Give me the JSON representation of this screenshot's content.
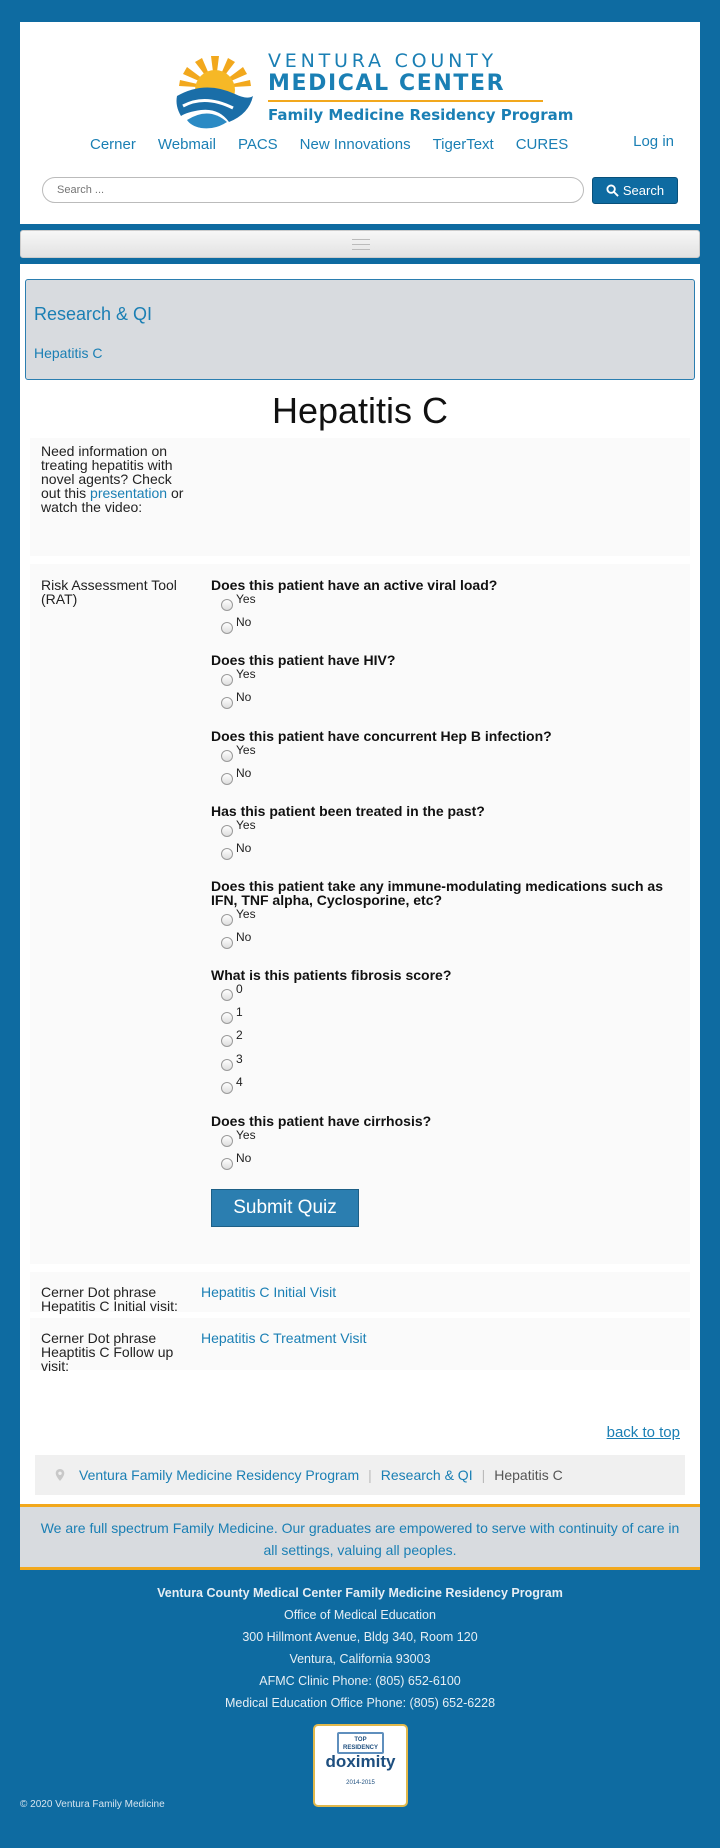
{
  "header": {
    "logo": {
      "line1": "VENTURA COUNTY",
      "line2": "MEDICAL CENTER",
      "line3": "Family Medicine Residency Program"
    },
    "nav": [
      "Cerner",
      "Webmail",
      "PACS",
      "New Innovations",
      "TigerText",
      "CURES"
    ],
    "login_label": "Log in",
    "search": {
      "placeholder": "Search ...",
      "button_label": "Search"
    }
  },
  "breadcrumb_box": {
    "title": "Research & QI",
    "subtitle": "Hepatitis C"
  },
  "page_title": "Hepatitis C",
  "info": {
    "text_before": "Need information on treating hepatitis with novel agents?  Check out this",
    "link": "presentation",
    "text_after": "or watch the video:"
  },
  "rat": {
    "label": "Risk Assessment Tool (RAT)",
    "questions": [
      {
        "q": "Does this patient have an active viral load?",
        "options": [
          "Yes",
          "No"
        ]
      },
      {
        "q": "Does this patient have HIV?",
        "options": [
          "Yes",
          "No"
        ]
      },
      {
        "q": "Does this patient have concurrent Hep B infection?",
        "options": [
          "Yes",
          "No"
        ]
      },
      {
        "q": "Has this patient been treated in the past?",
        "options": [
          "Yes",
          "No"
        ]
      },
      {
        "q": "Does this patient take any immune-modulating medications such as IFN, TNF alpha, Cyclosporine, etc?",
        "options": [
          "Yes",
          "No"
        ]
      },
      {
        "q": "What is this patients fibrosis score?",
        "options": [
          "0",
          "1",
          "2",
          "3",
          "4"
        ]
      },
      {
        "q": "Does this patient have cirrhosis?",
        "options": [
          "Yes",
          "No"
        ]
      }
    ],
    "submit_label": "Submit Quiz"
  },
  "dot_phrases": [
    {
      "label": "Cerner Dot phrase Hepatitis C Initial visit:",
      "link": "Hepatitis C Initial Visit"
    },
    {
      "label": "Cerner Dot phrase Heaptitis C Follow up visit:",
      "link": "Hepatitis C Treatment Visit"
    }
  ],
  "back_to_top": "back to top",
  "breadcrumbs": [
    "Ventura Family Medicine Residency Program",
    "Research & QI",
    "Hepatitis C"
  ],
  "tagline": "We are full spectrum Family Medicine. Our graduates are empowered to serve with continuity of care in all settings, valuing all peoples.",
  "footer": {
    "org": "Ventura County Medical Center Family Medicine Residency Program",
    "lines": [
      "Office of Medical Education",
      "300 Hillmont Avenue, Bldg 340, Room 120",
      "Ventura, California 93003",
      "AFMC Clinic Phone: (805) 652-6100",
      "Medical Education Office Phone: (805) 652-6228"
    ],
    "badge": {
      "top": "TOP RESIDENCY",
      "name": "doximity",
      "years": "2014-2015"
    },
    "copyright": "© 2020 Ventura Family Medicine"
  },
  "colors": {
    "brand_blue": "#0e6ba1",
    "link_blue": "#1a7fb4",
    "accent_gold": "#f2a81d"
  }
}
